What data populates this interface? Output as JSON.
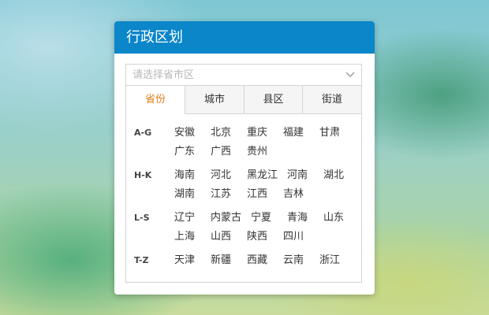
{
  "panel": {
    "title": "行政区划",
    "select": {
      "placeholder": "请选择省市区",
      "value": ""
    },
    "tabs": [
      {
        "label": "省份",
        "active": true
      },
      {
        "label": "城市",
        "active": false
      },
      {
        "label": "县区",
        "active": false
      },
      {
        "label": "街道",
        "active": false
      }
    ],
    "groups": [
      {
        "label": "A-G",
        "items": [
          "安徽",
          "北京",
          "重庆",
          "福建",
          "甘肃",
          "广东",
          "广西",
          "贵州"
        ]
      },
      {
        "label": "H-K",
        "items": [
          "海南",
          "河北",
          "黑龙江",
          "河南",
          "湖北",
          "湖南",
          "江苏",
          "江西",
          "吉林"
        ]
      },
      {
        "label": "L-S",
        "items": [
          "辽宁",
          "内蒙古",
          "宁夏",
          "青海",
          "山东",
          "上海",
          "山西",
          "陕西",
          "四川"
        ]
      },
      {
        "label": "T-Z",
        "items": [
          "天津",
          "新疆",
          "西藏",
          "云南",
          "浙江"
        ]
      }
    ]
  },
  "colors": {
    "header": "#0a86c9",
    "active_tab_text": "#e2801a",
    "border": "#d4d4d4"
  },
  "icons": {
    "dropdown": "chevron-down-icon"
  }
}
